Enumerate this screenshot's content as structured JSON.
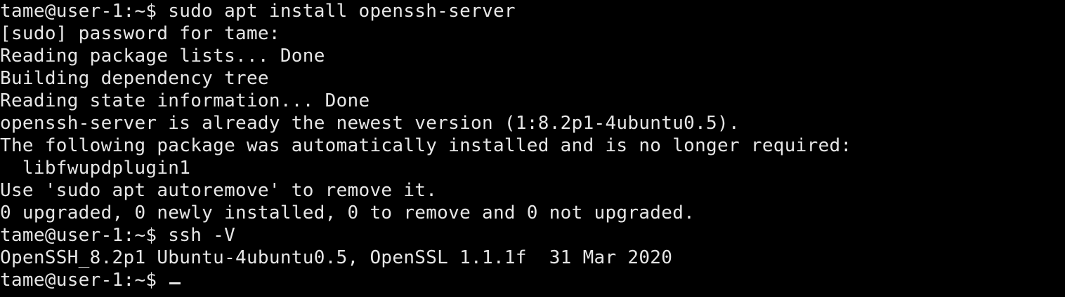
{
  "terminal": {
    "colors": {
      "background": "#000000",
      "foreground": "#e6e6e6"
    },
    "lines": [
      "tame@user-1:~$ sudo apt install openssh-server",
      "[sudo] password for tame:",
      "Reading package lists... Done",
      "Building dependency tree",
      "Reading state information... Done",
      "openssh-server is already the newest version (1:8.2p1-4ubuntu0.5).",
      "The following package was automatically installed and is no longer required:",
      "  libfwupdplugin1",
      "Use 'sudo apt autoremove' to remove it.",
      "0 upgraded, 0 newly installed, 0 to remove and 0 not upgraded.",
      "tame@user-1:~$ ssh -V",
      "OpenSSH_8.2p1 Ubuntu-4ubuntu0.5, OpenSSL 1.1.1f  31 Mar 2020"
    ],
    "prompt": "tame@user-1:~$ "
  }
}
